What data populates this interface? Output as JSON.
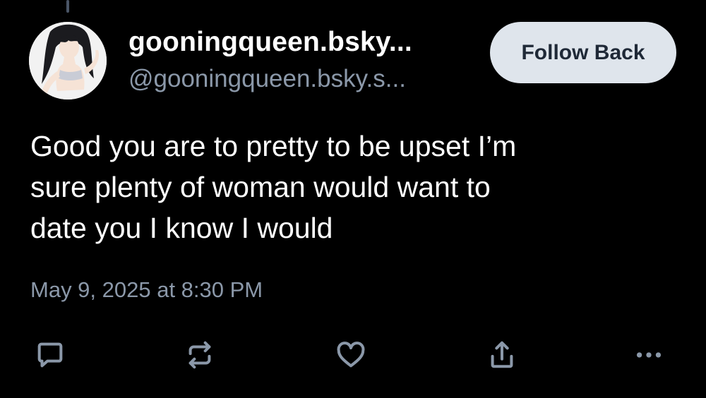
{
  "post": {
    "author": {
      "display_name": "gooningqueen.bsky...",
      "handle": "@gooningqueen.bsky.s..."
    },
    "follow_button_label": "Follow Back",
    "text_lines": [
      "Good you are to pretty to be upset I’m",
      "sure plenty of woman would want to",
      "date you I know I would"
    ],
    "timestamp": "May 9, 2025 at 8:30 PM"
  },
  "actions": [
    {
      "icon": "reply-icon"
    },
    {
      "icon": "repost-icon"
    },
    {
      "icon": "like-icon"
    },
    {
      "icon": "share-icon"
    },
    {
      "icon": "more-icon"
    }
  ],
  "colors": {
    "background": "#000000",
    "text_primary": "#ffffff",
    "text_secondary": "#8b98a9",
    "button_bg": "#dfe5ec",
    "button_text": "#1f2937",
    "thread_line": "#4a5566"
  }
}
